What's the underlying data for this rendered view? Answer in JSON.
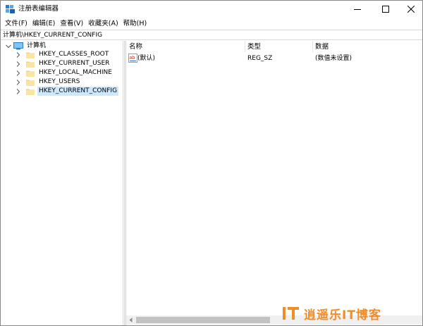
{
  "window": {
    "title": "注册表编辑器",
    "minimize_label": "minimize",
    "maximize_label": "maximize",
    "close_label": "close"
  },
  "menu": [
    {
      "label": "文件(F)"
    },
    {
      "label": "编辑(E)"
    },
    {
      "label": "查看(V)"
    },
    {
      "label": "收藏夹(A)"
    },
    {
      "label": "帮助(H)"
    }
  ],
  "address": {
    "path": "计算机\\HKEY_CURRENT_CONFIG"
  },
  "tree": {
    "root": {
      "label": "计算机",
      "expanded": true
    },
    "children": [
      {
        "label": "HKEY_CLASSES_ROOT",
        "selected": false
      },
      {
        "label": "HKEY_CURRENT_USER",
        "selected": false
      },
      {
        "label": "HKEY_LOCAL_MACHINE",
        "selected": false
      },
      {
        "label": "HKEY_USERS",
        "selected": false
      },
      {
        "label": "HKEY_CURRENT_CONFIG",
        "selected": true
      }
    ]
  },
  "list": {
    "columns": [
      "名称",
      "类型",
      "数据"
    ],
    "rows": [
      {
        "name": "(默认)",
        "type": "REG_SZ",
        "data": "(数值未设置)"
      }
    ]
  },
  "watermark": {
    "text_main": "逍遥乐",
    "text_it": "IT",
    "text_tail": "博客"
  },
  "colors": {
    "selection": "#cce8ff",
    "folder": "#f5d37a",
    "watermark": "#f28c28"
  }
}
